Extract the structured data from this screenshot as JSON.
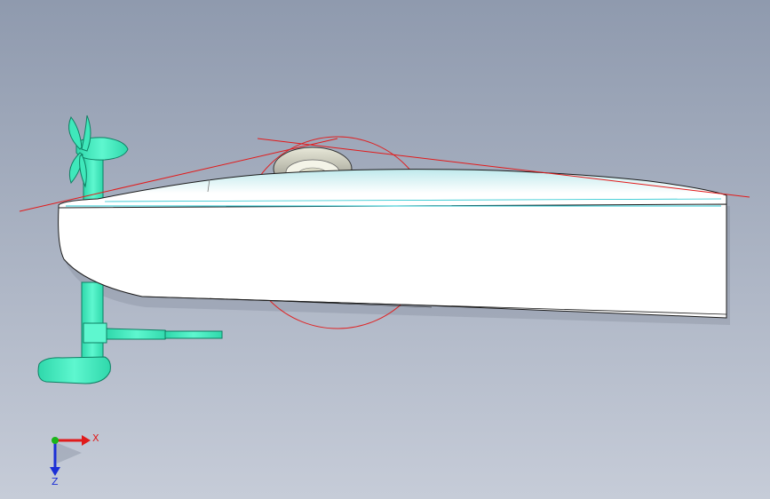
{
  "colors": {
    "background_top": "#8f9aae",
    "background_bottom": "#c6ccd8",
    "hull_fill": "#ffffff",
    "hull_stroke": "#1c1c1c",
    "hull_highlight": "#cfeff0",
    "part_green": "#39f0bf",
    "part_green_dark": "#0f7f63",
    "sketch_red": "#e21b1b",
    "centerline_cyan": "#21c5cf",
    "axis_x": "#e01b1b",
    "axis_y": "#1ab51a",
    "axis_z": "#1b2fd6"
  },
  "triad": {
    "x_label": "X",
    "z_label": "Z"
  }
}
